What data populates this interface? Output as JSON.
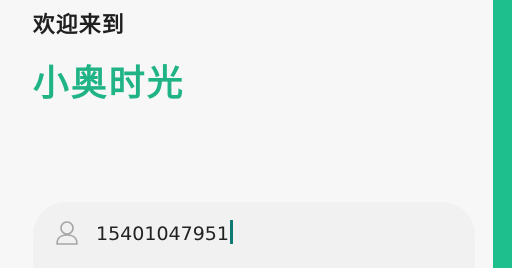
{
  "header": {
    "welcome_text": "欢迎来到",
    "app_name": "小奥时光"
  },
  "login": {
    "phone_value": "15401047951",
    "icon": "user-icon"
  },
  "colors": {
    "accent": "#1fb386",
    "side_bar": "#1fbf8d",
    "caret": "#0e7a74",
    "background": "#f7f7f7",
    "field_background": "#f1f1f1"
  }
}
